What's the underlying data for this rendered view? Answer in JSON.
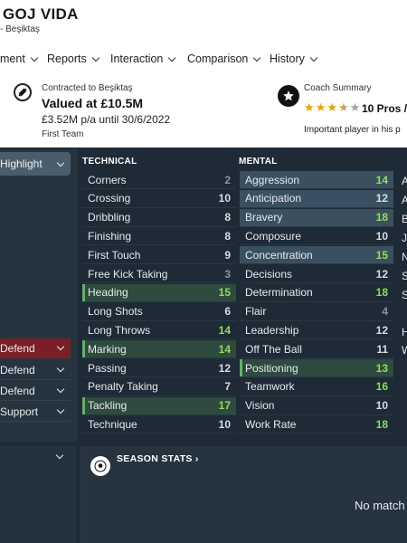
{
  "player": {
    "name": "GOJ VIDA",
    "subtitle": "- Beşiktaş"
  },
  "menu": [
    {
      "label": "ment"
    },
    {
      "label": "Reports"
    },
    {
      "label": "Interaction"
    },
    {
      "label": "Comparison"
    },
    {
      "label": "History"
    }
  ],
  "contract": {
    "label": "Contracted to Beşiktaş",
    "value": "Valued at £10.5M",
    "wage": "£3.52M p/a until 30/6/2022",
    "squad": "First Team"
  },
  "coach": {
    "label": "Coach Summary",
    "stars_full": 3.5,
    "stars_total": 5,
    "pros": "10 Pros /",
    "description": "Important player in his p"
  },
  "sidebar": {
    "highlight_label": "Highlight",
    "roles": [
      {
        "label": "Defend",
        "active": true
      },
      {
        "label": "Defend",
        "active": false
      },
      {
        "label": "Defend",
        "active": false
      },
      {
        "label": "Support",
        "active": false
      }
    ]
  },
  "attributes": {
    "technical_header": "TECHNICAL",
    "mental_header": "MENTAL",
    "physical_header": "PH",
    "technical": [
      {
        "name": "Corners",
        "value": "2",
        "style": "none"
      },
      {
        "name": "Crossing",
        "value": "10",
        "style": "none"
      },
      {
        "name": "Dribbling",
        "value": "8",
        "style": "none"
      },
      {
        "name": "Finishing",
        "value": "8",
        "style": "none"
      },
      {
        "name": "First Touch",
        "value": "9",
        "style": "none"
      },
      {
        "name": "Free Kick Taking",
        "value": "3",
        "style": "none"
      },
      {
        "name": "Heading",
        "value": "15",
        "style": "pos"
      },
      {
        "name": "Long Shots",
        "value": "6",
        "style": "none"
      },
      {
        "name": "Long Throws",
        "value": "14",
        "style": "none"
      },
      {
        "name": "Marking",
        "value": "14",
        "style": "pos"
      },
      {
        "name": "Passing",
        "value": "12",
        "style": "none"
      },
      {
        "name": "Penalty Taking",
        "value": "7",
        "style": "none"
      },
      {
        "name": "Tackling",
        "value": "17",
        "style": "pos"
      },
      {
        "name": "Technique",
        "value": "10",
        "style": "none"
      }
    ],
    "mental": [
      {
        "name": "Aggression",
        "value": "14",
        "style": "hl"
      },
      {
        "name": "Anticipation",
        "value": "12",
        "style": "hl"
      },
      {
        "name": "Bravery",
        "value": "18",
        "style": "hl"
      },
      {
        "name": "Composure",
        "value": "10",
        "style": "none"
      },
      {
        "name": "Concentration",
        "value": "15",
        "style": "hl"
      },
      {
        "name": "Decisions",
        "value": "12",
        "style": "none"
      },
      {
        "name": "Determination",
        "value": "18",
        "style": "none"
      },
      {
        "name": "Flair",
        "value": "4",
        "style": "none"
      },
      {
        "name": "Leadership",
        "value": "12",
        "style": "none"
      },
      {
        "name": "Off The Ball",
        "value": "11",
        "style": "none"
      },
      {
        "name": "Positioning",
        "value": "13",
        "style": "pos"
      },
      {
        "name": "Teamwork",
        "value": "16",
        "style": "none"
      },
      {
        "name": "Vision",
        "value": "10",
        "style": "none"
      },
      {
        "name": "Work Rate",
        "value": "18",
        "style": "none"
      }
    ],
    "physical_letters": [
      "A",
      "A",
      "B",
      "J",
      "N",
      "S",
      "S",
      "H",
      "W"
    ]
  },
  "season": {
    "title": "SEASON STATS ›",
    "empty_text": "No match"
  }
}
